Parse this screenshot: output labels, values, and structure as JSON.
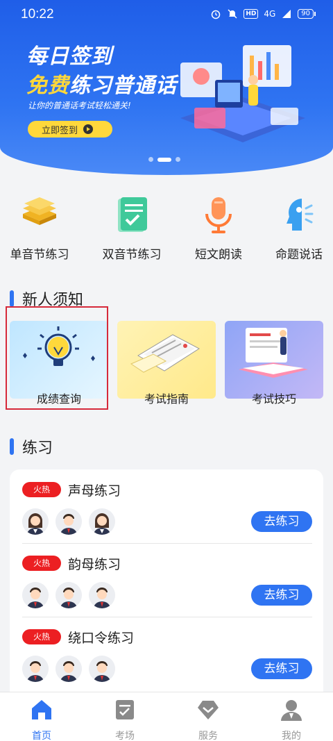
{
  "status_bar": {
    "time": "10:22",
    "hd": "HD",
    "network": "4G",
    "battery": "90"
  },
  "banner": {
    "line1": "每日签到",
    "line2_highlight": "免费",
    "line2_rest": "练习普通话",
    "subtitle": "让你的普通话考试轻松通关!",
    "button_label": "立即签到"
  },
  "categories": [
    {
      "label": "单音节练习",
      "icon": "stack-icon"
    },
    {
      "label": "双音节练习",
      "icon": "checklist-icon"
    },
    {
      "label": "短文朗读",
      "icon": "microphone-icon"
    },
    {
      "label": "命题说话",
      "icon": "speaking-head-icon"
    }
  ],
  "notice_section": {
    "title": "新人须知",
    "cards": [
      {
        "label": "成绩查询",
        "icon": "lightbulb-icon"
      },
      {
        "label": "考试指南",
        "icon": "document-icon"
      },
      {
        "label": "考试技巧",
        "icon": "book-icon"
      }
    ]
  },
  "practice_section": {
    "title": "练习",
    "items": [
      {
        "badge": "火热",
        "title": "声母练习",
        "button": "去练习"
      },
      {
        "badge": "火热",
        "title": "韵母练习",
        "button": "去练习"
      },
      {
        "badge": "火热",
        "title": "绕口令练习",
        "button": "去练习"
      }
    ]
  },
  "tabbar": {
    "tabs": [
      {
        "label": "首页",
        "icon": "home-icon",
        "active": true
      },
      {
        "label": "考场",
        "icon": "exam-icon",
        "active": false
      },
      {
        "label": "服务",
        "icon": "service-icon",
        "active": false
      },
      {
        "label": "我的",
        "icon": "profile-icon",
        "active": false
      }
    ]
  },
  "colors": {
    "primary": "#2f74f2",
    "hot_badge": "#ec1f22",
    "highlight_yellow": "#ffd83b",
    "annotation_red": "#d6293a"
  }
}
